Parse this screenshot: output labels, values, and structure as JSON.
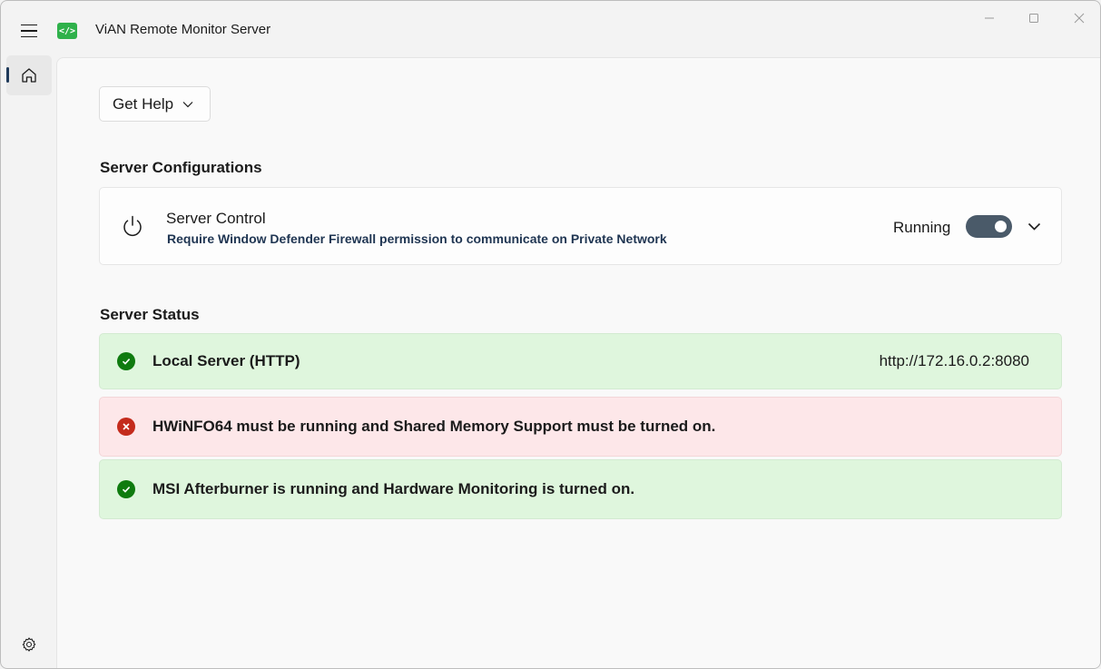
{
  "app": {
    "title": "ViAN Remote Monitor Server",
    "icon_text": "</>",
    "brand_color": "#2fb14b"
  },
  "toolbar": {
    "help_label": "Get Help"
  },
  "config": {
    "section_title": "Server Configurations",
    "control_title": "Server Control",
    "control_desc": "Require Window Defender Firewall permission to communicate on Private Network",
    "state_label": "Running",
    "toggle_on": true
  },
  "status": {
    "section_title": "Server Status",
    "items": [
      {
        "state": "ok",
        "text": "Local Server (HTTP)",
        "url": "http://172.16.0.2:8080"
      },
      {
        "state": "error",
        "text": "HWiNFO64 must be running and Shared Memory Support must be turned on."
      },
      {
        "state": "ok",
        "text": "MSI Afterburner is running and Hardware Monitoring is turned on."
      }
    ],
    "colors": {
      "ok": "#0f7b0f",
      "error": "#c42b1c",
      "ok_bg": "#dff6dd",
      "error_bg": "#fde7e9"
    }
  },
  "icons": [
    "hamburger-icon",
    "home-icon",
    "settings-icon",
    "power-icon",
    "chevron-down-icon",
    "check-icon",
    "close-icon"
  ]
}
